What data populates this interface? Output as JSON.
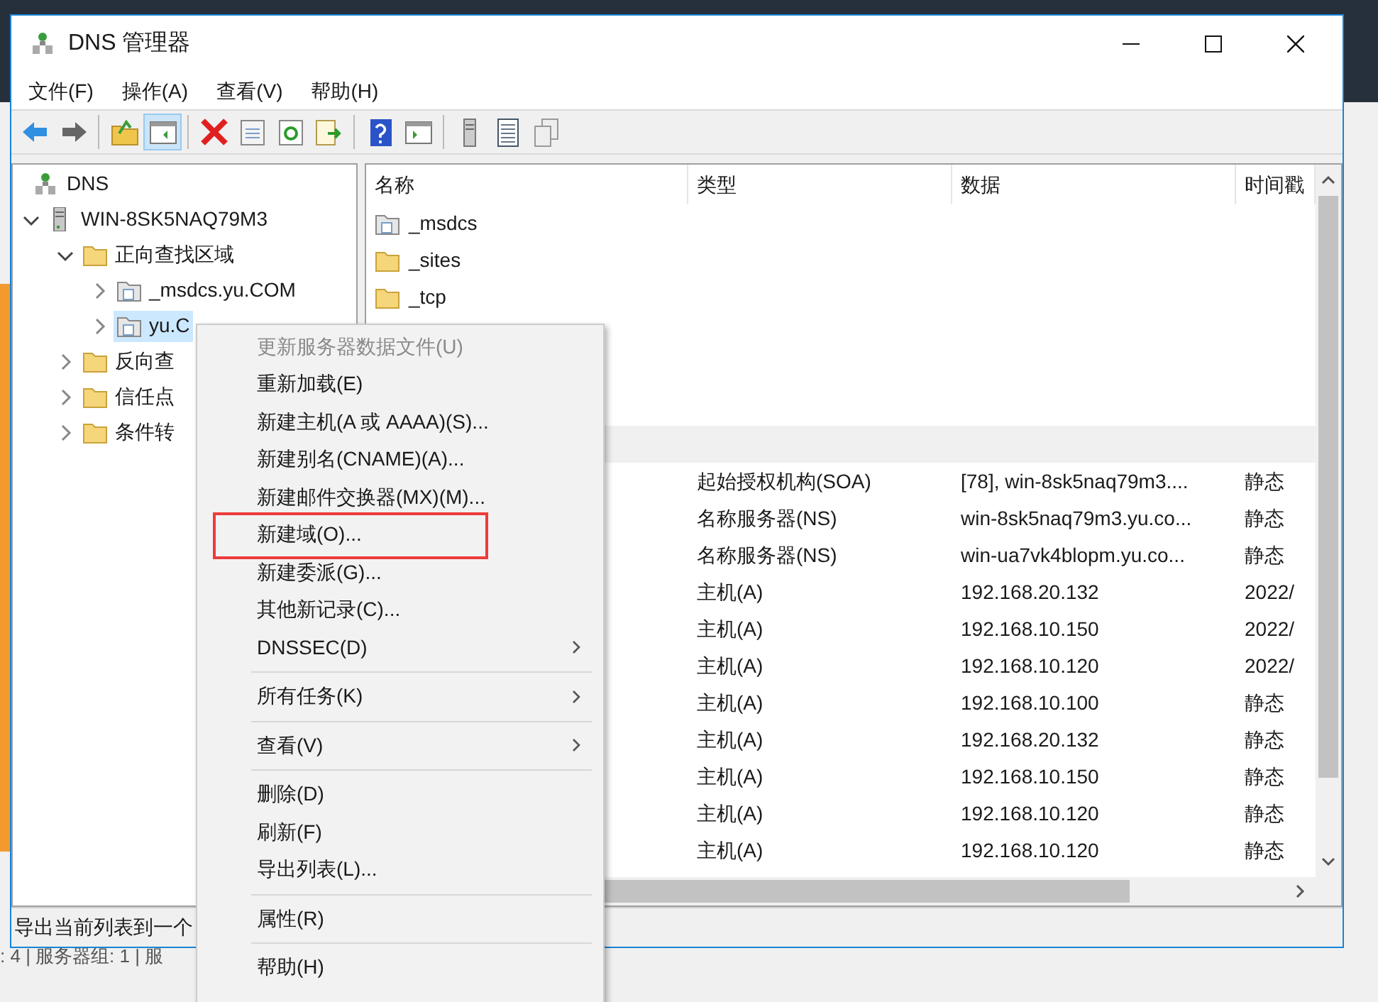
{
  "window": {
    "title": "DNS 管理器"
  },
  "menu_bar": [
    "文件(F)",
    "操作(A)",
    "查看(V)",
    "帮助(H)"
  ],
  "toolbar": [
    {
      "kind": "back",
      "pressed": false
    },
    {
      "kind": "forward",
      "pressed": false
    },
    {
      "kind": "separator"
    },
    {
      "kind": "up",
      "pressed": false
    },
    {
      "kind": "tree",
      "pressed": true
    },
    {
      "kind": "separator"
    },
    {
      "kind": "delete",
      "pressed": false
    },
    {
      "kind": "properties",
      "pressed": false
    },
    {
      "kind": "refresh",
      "pressed": false
    },
    {
      "kind": "export",
      "pressed": false
    },
    {
      "kind": "separator"
    },
    {
      "kind": "help",
      "pressed": false
    },
    {
      "kind": "pane",
      "pressed": false
    },
    {
      "kind": "separator"
    },
    {
      "kind": "server",
      "pressed": false
    },
    {
      "kind": "list",
      "pressed": false
    },
    {
      "kind": "copy",
      "pressed": false
    }
  ],
  "tree": [
    {
      "label": "DNS",
      "kind": "dns",
      "selected": false,
      "children": [
        {
          "label": "WIN-8SK5NAQ79M3",
          "kind": "server",
          "expanded": true,
          "selected": false,
          "children": [
            {
              "label": "正向查找区域",
              "kind": "folder",
              "expanded": true,
              "selected": false,
              "children": [
                {
                  "label": "_msdcs.yu.COM",
                  "kind": "zone",
                  "expanded": false,
                  "selected": false
                },
                {
                  "label": "yu.C",
                  "kind": "zone",
                  "expanded": false,
                  "selected": true
                }
              ]
            },
            {
              "label": "反向查",
              "kind": "folder",
              "expanded": false,
              "selected": false
            },
            {
              "label": "信任点",
              "kind": "folder",
              "expanded": false,
              "selected": false
            },
            {
              "label": "条件转",
              "kind": "folder",
              "expanded": false,
              "selected": false
            }
          ]
        }
      ]
    }
  ],
  "table": {
    "columns": [
      "名称",
      "类型",
      "数据",
      "时间戳"
    ],
    "rows": [
      {
        "name": "_msdcs",
        "kind": "zone",
        "selected": false
      },
      {
        "name": "_sites",
        "kind": "folder",
        "selected": false
      },
      {
        "name": "_tcp",
        "kind": "folder",
        "selected": false
      },
      {
        "selected": true
      },
      {
        "type": "起始授权机构(SOA)",
        "data": "[78], win-8sk5naq79m3....",
        "timestamp": "静态",
        "selected": false
      },
      {
        "type": "名称服务器(NS)",
        "data": "win-8sk5naq79m3.yu.co...",
        "timestamp": "静态",
        "selected": false
      },
      {
        "type": "名称服务器(NS)",
        "data": "win-ua7vk4blopm.yu.co...",
        "timestamp": "静态",
        "selected": false
      },
      {
        "type": "主机(A)",
        "data": "192.168.20.132",
        "timestamp": "2022/",
        "selected": false
      },
      {
        "type": "主机(A)",
        "data": "192.168.10.150",
        "timestamp": "2022/",
        "selected": false
      },
      {
        "type": "主机(A)",
        "data": "192.168.10.120",
        "timestamp": "2022/",
        "selected": false
      },
      {
        "type": "主机(A)",
        "data": "192.168.10.100",
        "timestamp": "静态",
        "selected": false
      },
      {
        "type": "主机(A)",
        "data": "192.168.20.132",
        "timestamp": "静态",
        "selected": false
      },
      {
        "type": "主机(A)",
        "data": "192.168.10.150",
        "timestamp": "静态",
        "selected": false
      },
      {
        "type": "主机(A)",
        "data": "192.168.10.120",
        "timestamp": "静态",
        "selected": false
      },
      {
        "type": "主机(A)",
        "data": "192.168.10.120",
        "timestamp": "静态",
        "selected": false
      }
    ]
  },
  "status_bar": "导出当前列表到一个",
  "background_app": {
    "status_text": ": 4 | 服务器组: 1 | 服"
  },
  "context_menu": [
    {
      "kind": "item",
      "label": "更新服务器数据文件(U)",
      "disabled": true,
      "submenu": false,
      "outlined": false
    },
    {
      "kind": "item",
      "label": "重新加载(E)",
      "disabled": false,
      "submenu": false,
      "outlined": false
    },
    {
      "kind": "item",
      "label": "新建主机(A 或 AAAA)(S)...",
      "disabled": false,
      "submenu": false,
      "outlined": false
    },
    {
      "kind": "item",
      "label": "新建别名(CNAME)(A)...",
      "disabled": false,
      "submenu": false,
      "outlined": false
    },
    {
      "kind": "item",
      "label": "新建邮件交换器(MX)(M)...",
      "disabled": false,
      "submenu": false,
      "outlined": false
    },
    {
      "kind": "item",
      "label": "新建域(O)...",
      "disabled": false,
      "submenu": false,
      "outlined": true
    },
    {
      "kind": "item",
      "label": "新建委派(G)...",
      "disabled": false,
      "submenu": false,
      "outlined": false
    },
    {
      "kind": "item",
      "label": "其他新记录(C)...",
      "disabled": false,
      "submenu": false,
      "outlined": false
    },
    {
      "kind": "item",
      "label": "DNSSEC(D)",
      "disabled": false,
      "submenu": true,
      "outlined": false
    },
    {
      "kind": "separator"
    },
    {
      "kind": "item",
      "label": "所有任务(K)",
      "disabled": false,
      "submenu": true,
      "outlined": false
    },
    {
      "kind": "separator"
    },
    {
      "kind": "item",
      "label": "查看(V)",
      "disabled": false,
      "submenu": true,
      "outlined": false
    },
    {
      "kind": "separator"
    },
    {
      "kind": "item",
      "label": "删除(D)",
      "disabled": false,
      "submenu": false,
      "outlined": false
    },
    {
      "kind": "item",
      "label": "刷新(F)",
      "disabled": false,
      "submenu": false,
      "outlined": false
    },
    {
      "kind": "item",
      "label": "导出列表(L)...",
      "disabled": false,
      "submenu": false,
      "outlined": false
    },
    {
      "kind": "separator"
    },
    {
      "kind": "item",
      "label": "属性(R)",
      "disabled": false,
      "submenu": false,
      "outlined": false
    },
    {
      "kind": "separator"
    },
    {
      "kind": "item",
      "label": "帮助(H)",
      "disabled": false,
      "submenu": false,
      "outlined": false
    }
  ]
}
